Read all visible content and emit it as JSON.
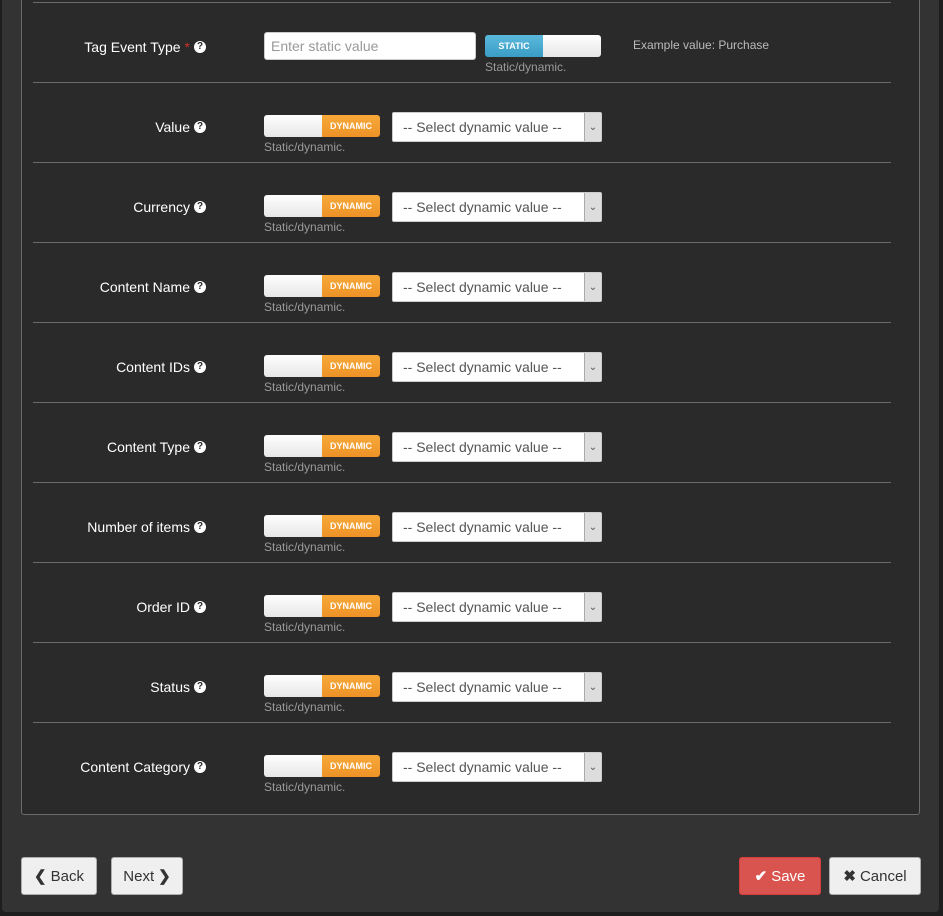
{
  "fields": [
    {
      "label": "Tag Event Type",
      "required": true,
      "mode": "static",
      "toggle_label": "STATIC",
      "input_placeholder": "Enter static value",
      "help": "Static/dynamic.",
      "example": "Example value: Purchase"
    },
    {
      "label": "Value",
      "required": false,
      "mode": "dynamic",
      "toggle_label": "DYNAMIC",
      "select_value": "-- Select dynamic value --",
      "help": "Static/dynamic."
    },
    {
      "label": "Currency",
      "required": false,
      "mode": "dynamic",
      "toggle_label": "DYNAMIC",
      "select_value": "-- Select dynamic value --",
      "help": "Static/dynamic."
    },
    {
      "label": "Content Name",
      "required": false,
      "mode": "dynamic",
      "toggle_label": "DYNAMIC",
      "select_value": "-- Select dynamic value --",
      "help": "Static/dynamic."
    },
    {
      "label": "Content IDs",
      "required": false,
      "mode": "dynamic",
      "toggle_label": "DYNAMIC",
      "select_value": "-- Select dynamic value --",
      "help": "Static/dynamic."
    },
    {
      "label": "Content Type",
      "required": false,
      "mode": "dynamic",
      "toggle_label": "DYNAMIC",
      "select_value": "-- Select dynamic value --",
      "help": "Static/dynamic."
    },
    {
      "label": "Number of items",
      "required": false,
      "mode": "dynamic",
      "toggle_label": "DYNAMIC",
      "select_value": "-- Select dynamic value --",
      "help": "Static/dynamic."
    },
    {
      "label": "Order ID",
      "required": false,
      "mode": "dynamic",
      "toggle_label": "DYNAMIC",
      "select_value": "-- Select dynamic value --",
      "help": "Static/dynamic."
    },
    {
      "label": "Status",
      "required": false,
      "mode": "dynamic",
      "toggle_label": "DYNAMIC",
      "select_value": "-- Select dynamic value --",
      "help": "Static/dynamic."
    },
    {
      "label": "Content Category",
      "required": false,
      "mode": "dynamic",
      "toggle_label": "DYNAMIC",
      "select_value": "-- Select dynamic value --",
      "help": "Static/dynamic."
    }
  ],
  "required_mark": "*",
  "help_icon": "question-circle-icon",
  "help_glyph": "?",
  "footer": {
    "back_label": "Back",
    "next_label": "Next",
    "save_label": "Save",
    "cancel_label": "Cancel"
  },
  "colors": {
    "static_toggle": "#3a9dc6",
    "dynamic_toggle": "#ee9227",
    "save_button": "#d9534f",
    "required": "#c9302c"
  }
}
